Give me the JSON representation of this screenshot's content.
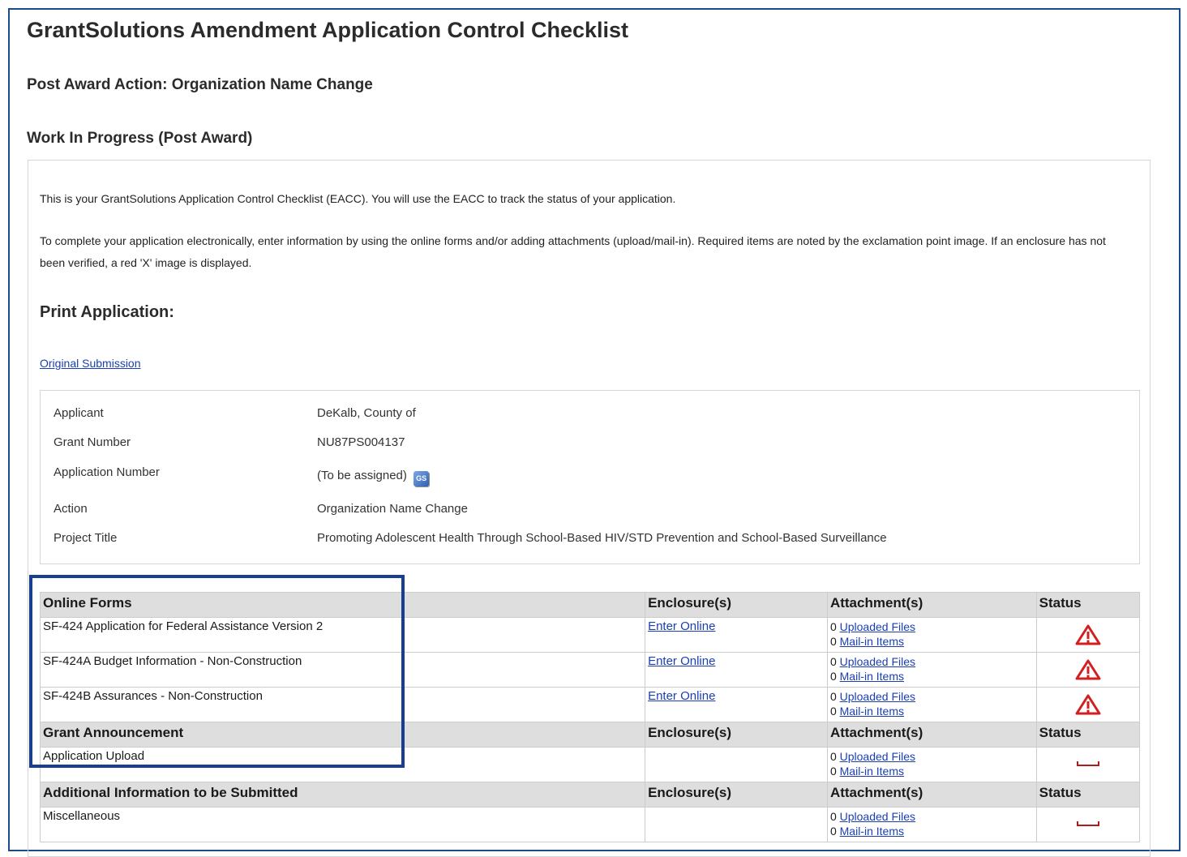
{
  "page": {
    "title": "GrantSolutions Amendment Application Control Checklist",
    "post_award_action": "Post Award Action: Organization Name Change",
    "status_heading": "Work In Progress (Post Award)"
  },
  "intro": {
    "paragraph1": "This is your GrantSolutions Application Control Checklist (EACC). You will use the EACC to track the status of your application.",
    "paragraph2": "To complete your application electronically, enter information by using the online forms and/or adding attachments (upload/mail-in).  Required items are noted by the exclamation point image.  If an enclosure has not been verified, a red 'X' image is displayed."
  },
  "print_application": {
    "heading": "Print Application:",
    "link_label": "Original Submission"
  },
  "application_info": [
    {
      "label": "Applicant",
      "value": "DeKalb, County of"
    },
    {
      "label": "Grant Number",
      "value": "NU87PS004137"
    },
    {
      "label": "Application Number",
      "value": "(To be assigned)",
      "icon": "gs-icon"
    },
    {
      "label": "Action",
      "value": "Organization Name Change"
    },
    {
      "label": "Project Title",
      "value": "Promoting Adolescent Health Through School-Based HIV/STD Prevention and School-Based Surveillance"
    }
  ],
  "checklist": {
    "sections": [
      {
        "header": {
          "name": "Online Forms",
          "enclosures": "Enclosure(s)",
          "attachments": "Attachment(s)",
          "status": "Status"
        },
        "rows": [
          {
            "name": "SF-424 Application for Federal Assistance Version 2",
            "enclosure": "Enter Online",
            "uploaded_count": "0",
            "uploaded_label": "Uploaded Files",
            "mailin_count": "0",
            "mailin_label": "Mail-in Items",
            "status": "warning-icon"
          },
          {
            "name": "SF-424A Budget Information - Non-Construction",
            "enclosure": "Enter Online",
            "uploaded_count": "0",
            "uploaded_label": "Uploaded Files",
            "mailin_count": "0",
            "mailin_label": "Mail-in Items",
            "status": "warning-icon"
          },
          {
            "name": "SF-424B Assurances - Non-Construction",
            "enclosure": "Enter Online",
            "uploaded_count": "0",
            "uploaded_label": "Uploaded Files",
            "mailin_count": "0",
            "mailin_label": "Mail-in Items",
            "status": "warning-icon"
          }
        ]
      },
      {
        "header": {
          "name": "Grant Announcement",
          "enclosures": "Enclosure(s)",
          "attachments": "Attachment(s)",
          "status": "Status"
        },
        "rows": [
          {
            "name": "Application Upload",
            "enclosure": "",
            "uploaded_count": "0",
            "uploaded_label": "Uploaded Files",
            "mailin_count": "0",
            "mailin_label": "Mail-in Items",
            "status": "pending-icon"
          }
        ]
      },
      {
        "header": {
          "name": "Additional Information to be Submitted",
          "enclosures": "Enclosure(s)",
          "attachments": "Attachment(s)",
          "status": "Status"
        },
        "rows": [
          {
            "name": "Miscellaneous",
            "enclosure": "",
            "uploaded_count": "0",
            "uploaded_label": "Uploaded Files",
            "mailin_count": "0",
            "mailin_label": "Mail-in Items",
            "status": "pending-icon"
          }
        ]
      }
    ]
  },
  "colors": {
    "highlight_border": "#173e8f",
    "link": "#1a3fb3",
    "warning": "#d21f1f",
    "header_bg": "#dedede"
  }
}
